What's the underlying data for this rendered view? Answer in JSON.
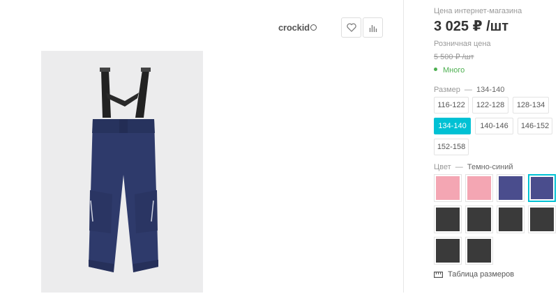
{
  "brand": {
    "name": "crockid"
  },
  "actions": {
    "favorite_icon": "heart-icon",
    "compare_icon": "bar-chart-icon"
  },
  "price": {
    "online_label": "Цена интернет-магазина",
    "online_value": "3 025 ₽ /шт",
    "retail_label": "Розничная цена",
    "retail_value": "5 500 ₽ /шт"
  },
  "stock": {
    "label": "Много",
    "color": "#4caf50"
  },
  "size": {
    "label": "Размер",
    "selected": "134-140",
    "options": [
      "116-122",
      "122-128",
      "128-134",
      "134-140",
      "140-146",
      "146-152",
      "152-158"
    ]
  },
  "color": {
    "label": "Цвет",
    "selected": "Темно-синий",
    "swatches": [
      "#f4a6b3",
      "#f4a6b3",
      "#4a4d8d",
      "#4a4d8d",
      "#3a3a3a",
      "#3a3a3a",
      "#3a3a3a",
      "#3a3a3a",
      "#3a3a3a",
      "#3a3a3a"
    ],
    "selected_index": 3
  },
  "size_table": {
    "label": "Таблица размеров",
    "icon": "ruler-icon"
  },
  "accent": "#00c1d4"
}
